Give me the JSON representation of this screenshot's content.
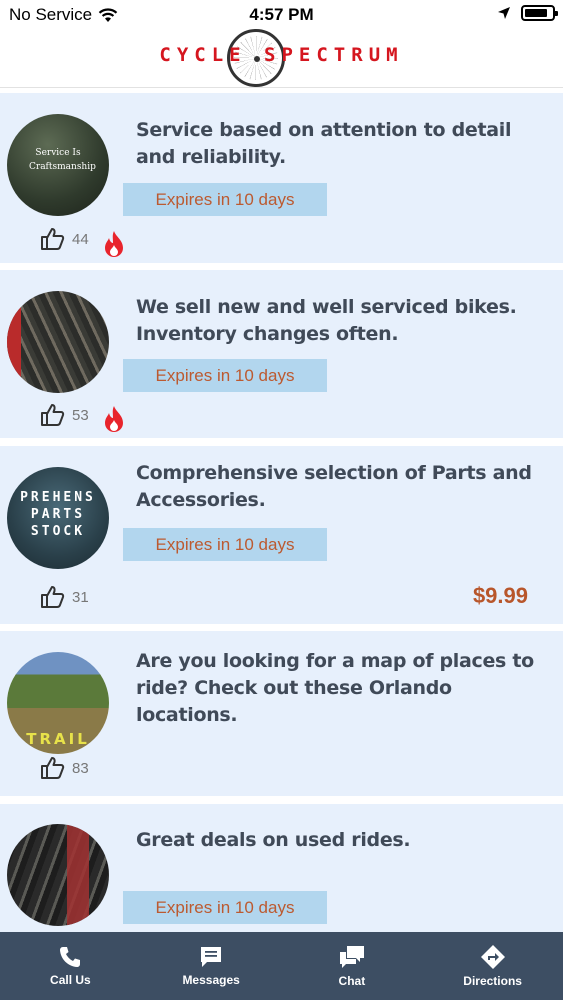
{
  "status_bar": {
    "carrier": "No Service",
    "time": "4:57 PM"
  },
  "header": {
    "logo_text": "CYCLE SPECTRUM"
  },
  "feed": [
    {
      "title": "Service based on attention to detail and reliability.",
      "expires": "Expires in 10 days",
      "likes": "44",
      "hot": true,
      "thumb_text": "Service Is Craftsmanship"
    },
    {
      "title": "We sell new and well serviced bikes. Inventory changes often.",
      "expires": "Expires in 10 days",
      "likes": "53",
      "hot": true
    },
    {
      "title": "Comprehensive selection of Parts and Accessories.",
      "expires": "Expires in 10 days",
      "likes": "31",
      "price": "$9.99",
      "thumb_text": "PREHENS PARTS STOCK"
    },
    {
      "title": "Are you looking for a map of places to ride? Check out these Orlando locations.",
      "likes": "83",
      "thumb_text": "TRAIL"
    },
    {
      "title": "Great deals on used rides.",
      "expires": "Expires in 10 days"
    }
  ],
  "tabs": {
    "call": "Call Us",
    "messages": "Messages",
    "chat": "Chat",
    "directions": "Directions"
  },
  "colors": {
    "accent": "#d5161f",
    "card_bg": "#e7f0fc",
    "expires_bg": "#b2d6ee",
    "tabbar_bg": "#3d4e63"
  }
}
